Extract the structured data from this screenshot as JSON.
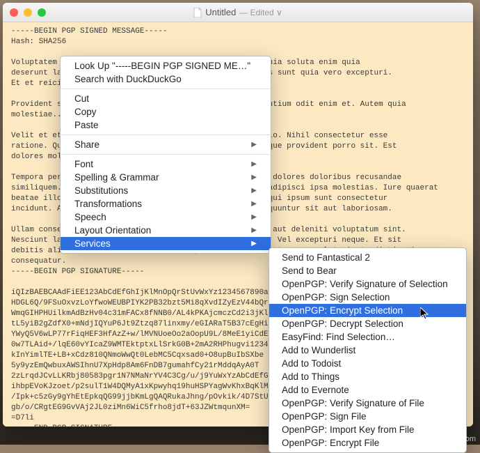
{
  "window": {
    "title": "Untitled",
    "edited_label": "— Edited ∨"
  },
  "document_text": "-----BEGIN PGP SIGNED MESSAGE-----\nHash: SHA256\n\nVoluptatem sunt voluptas dolorem nobis earum et neque. Quia soluta enim quia\ndeserunt laboriosam laboriosam rerum velit. Omnis aut eos sunt quia vero excepturi.\nEt et reiciendis iure repellendus ut...\n\nProvident sed rem vero quia vero nesciunt aliquam. Laudantium odit enim et. Autem quia\nmolestiae...\n\nVelit et et consequatur reprehenderit doloribus distinctio. Nihil consectetur esse\nratione. Quia consectetur dolore atque. Quo cum quae cumque provident porro sit. Est\ndolores mol...\n\nTempora perferendis excepturi ut quo eos doloribus sequi dolores doloribus recusandae\nsimiliquem. Consectetur sequi dolores similique. Minima adipisci ipsa molestias. Iure quaerat\nbeatae illo omnis blanditiis animi delectus eos. Dolore qui ipsum sunt consectetur\nincidunt. Atque labore minus repellat quo. Ratione consequuntur sit aut laboriosam.\n\nUllam consequatur itaque quos non. Quidem voluptate amet aut deleniti voluptatum sint.\nNesciunt laborum aliquid tempore et eos debitis adipisci. Vel excepturi neque. Et sit\ndebitis aliceros dolores blanditiis eos pariatur. Rerum est neque soluta iusto distinctio\nconsequatur.\n-----BEGIN PGP SIGNATURE-----\n\niQIzBAEBCAAdFiEE123AbCdEfGhIjKlMnOpQrStUvWxYz1234567890aBcDeFgHiJkLmNoP\nHDGL6Q/9FSuOxvzLoYfwoWEUBPIYK2PB32bzt5Mi8qXvdIZyEzV44bQr5tU6vW7xY8z9AbCdEfGh\nWmqGIHPHUilkmAdBzHv04c31mFACx8fNNB0/AL4kPKAjcmczCd2i3jKlMnOpQrStUvWxYzAbCdEf\ntL5yiB2gZdfX0+mNdjIQYuP6Jt9Ztzq87linxmy/eGIARaT5B37cEgHiJkLmNoPqRsStUvWxYzAb\nYWyQ5V6wLP77rFiqHEF3HfAzZ+w/lMVNUoeOo2aOopU9L/8MeE1yiCdEfGhIjKlMnOpQrStUvWxYz\n0w7TLAid+/lqE60vYIcaZ9WMTEktptxLlSrkG0B+2mA2RHPhugvi1234567890aBcDeFgHiJkLmNo\nkInYimlTE+LB+xCdz810QNmoWwQt0LebMC5Cqxsad0+O8upBuIbSXbe\n5y9yzEmQwbuxAWSIhnU7XpHdp8Am6FnDB7gumahfCy21rMddqAyA0T\n2zLrqdJCvLLKRbj80583pgr1N7NMaNrYV4C3Cg/u/j9YuWxYzAbCdEfGhIj\nihbpEVoKJzoet/p2sulT1W4DQMyA1xKpwyhq19huHSPYagWvKhxBqKlMnOpQr\n/Ipk+c5zGy9gYhEtEpkqQG99jjbKmLgQAQRukaJhng/pOvkik/4D7StUvWxYzAb\ngb/o/CRgtEG9GvVAj2JL0ziMn6WiC5frho8jdT+63JZWtmqunXM=\n=D7li\n-----END PGP SIGNATURE-----",
  "context_menu": {
    "lookup": "Look Up \"-----BEGIN PGP SIGNED ME…\"",
    "search": "Search with DuckDuckGo",
    "cut": "Cut",
    "copy": "Copy",
    "paste": "Paste",
    "share": "Share",
    "font": "Font",
    "spelling": "Spelling & Grammar",
    "substitutions": "Substitutions",
    "transformations": "Transformations",
    "speech": "Speech",
    "layout": "Layout Orientation",
    "services": "Services"
  },
  "services_submenu": [
    "Send to Fantastical 2",
    "Send to Bear",
    "OpenPGP: Verify Signature of Selection",
    "OpenPGP: Sign Selection",
    "OpenPGP: Encrypt Selection",
    "OpenPGP: Decrypt Selection",
    "EasyFind: Find Selection…",
    "Add to Wunderlist",
    "Add to Todoist",
    "Add to Things",
    "Add to Evernote",
    "OpenPGP: Verify Signature of File",
    "OpenPGP: Sign File",
    "OpenPGP: Import Key from File",
    "OpenPGP: Encrypt File"
  ],
  "services_highlight_index": 4,
  "watermark": "wsxdn.com"
}
